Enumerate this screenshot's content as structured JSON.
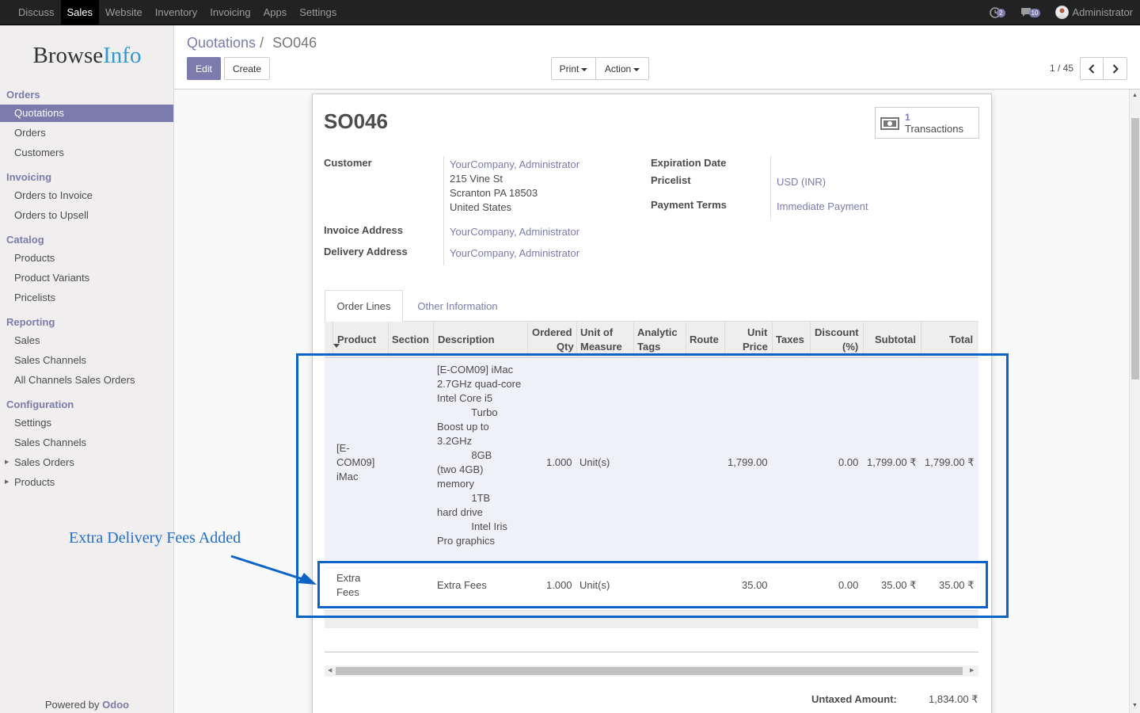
{
  "topbar": {
    "menu": [
      "Discuss",
      "Sales",
      "Website",
      "Inventory",
      "Invoicing",
      "Apps",
      "Settings"
    ],
    "active": "Sales",
    "chat_count": "2",
    "activity_count": "10",
    "user": "Administrator"
  },
  "sidebar": {
    "logo_a": "Browse",
    "logo_b": "Info",
    "sections": [
      {
        "title": "Orders",
        "items": [
          "Quotations",
          "Orders",
          "Customers"
        ]
      },
      {
        "title": "Invoicing",
        "items": [
          "Orders to Invoice",
          "Orders to Upsell"
        ]
      },
      {
        "title": "Catalog",
        "items": [
          "Products",
          "Product Variants",
          "Pricelists"
        ]
      },
      {
        "title": "Reporting",
        "items": [
          "Sales",
          "Sales Channels",
          "All Channels Sales Orders"
        ]
      },
      {
        "title": "Configuration",
        "items": [
          "Settings",
          "Sales Channels",
          "Sales Orders",
          "Products"
        ]
      }
    ],
    "powered_by": "Powered by",
    "powered_brand": "Odoo"
  },
  "breadcrumb": {
    "parent": "Quotations",
    "sep": "/",
    "current": "SO046"
  },
  "buttons": {
    "edit": "Edit",
    "create": "Create",
    "print": "Print",
    "action": "Action"
  },
  "pager": "1 / 45",
  "form": {
    "name": "SO046",
    "smart_count": "1",
    "smart_label": "Transactions",
    "customer_label": "Customer",
    "customer_name": "YourCompany, Administrator",
    "addr1": "215 Vine St",
    "addr2": "Scranton PA 18503",
    "addr3": "United States",
    "invoice_label": "Invoice Address",
    "invoice_value": "YourCompany, Administrator",
    "delivery_label": "Delivery Address",
    "delivery_value": "YourCompany, Administrator",
    "expiration_label": "Expiration Date",
    "pricelist_label": "Pricelist",
    "pricelist_value": "USD (INR)",
    "payment_label": "Payment Terms",
    "payment_value": "Immediate Payment"
  },
  "tabs": [
    "Order Lines",
    "Other Information"
  ],
  "table": {
    "headers": {
      "product": "Product",
      "section": "Section",
      "description": "Description",
      "qty_a": "Ordered",
      "qty_b": "Qty",
      "uom_a": "Unit of",
      "uom_b": "Measure",
      "tags_a": "Analytic",
      "tags_b": "Tags",
      "route": "Route",
      "price_a": "Unit",
      "price_b": "Price",
      "taxes": "Taxes",
      "disc_a": "Discount",
      "disc_b": "(%)",
      "subtotal": "Subtotal",
      "total": "Total"
    },
    "rows": [
      {
        "product": "[E-\nCOM09]\niMac",
        "description": "[E-COM09] iMac\n2.7GHz quad-core\nIntel Core i5\n            Turbo\nBoost up to\n3.2GHz\n            8GB\n(two 4GB)\nmemory\n            1TB\nhard drive\n            Intel Iris\nPro graphics",
        "qty": "1.000",
        "uom": "Unit(s)",
        "price": "1,799.00",
        "discount": "0.00",
        "subtotal": "1,799.00 ₹",
        "total": "1,799.00 ₹"
      },
      {
        "product": "Extra\nFees",
        "description": "Extra Fees",
        "qty": "1.000",
        "uom": "Unit(s)",
        "price": "35.00",
        "discount": "0.00",
        "subtotal": "35.00 ₹",
        "total": "35.00 ₹"
      }
    ]
  },
  "totals": {
    "untaxed_label": "Untaxed Amount:",
    "untaxed_value": "1,834.00 ₹"
  },
  "annotation": "Extra Delivery Fees Added",
  "colors": {
    "accent": "#7c7bad",
    "annotation": "#0d64c6",
    "logo_accent": "#2d9ad6"
  }
}
